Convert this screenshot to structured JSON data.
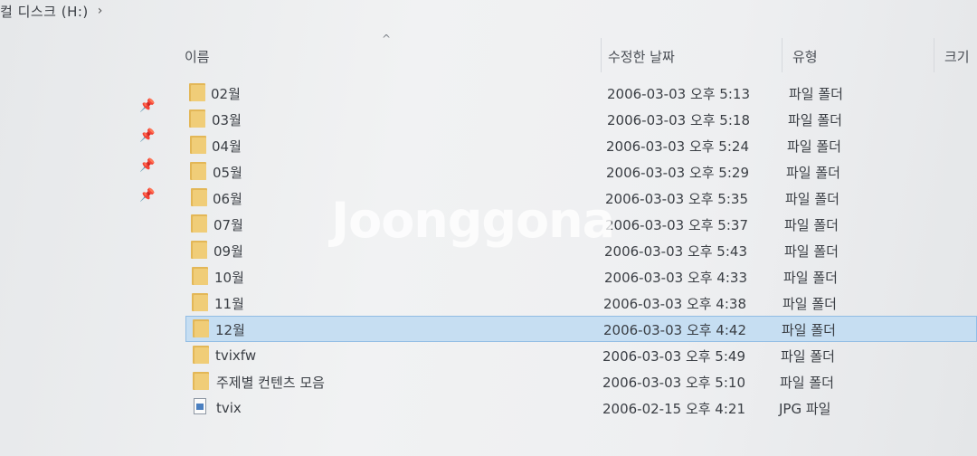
{
  "breadcrumb": {
    "text": "컬 디스크 (H:)",
    "chevron": "›"
  },
  "columns": {
    "name": "이름",
    "date": "수정한 날짜",
    "type": "유형",
    "size": "크기",
    "sort_indicator": "^"
  },
  "pins": [
    "pin-icon",
    "pin-icon",
    "pin-icon",
    "pin-icon"
  ],
  "files": [
    {
      "name": "02월",
      "date": "2006-03-03 오후 5:13",
      "type": "파일 폴더",
      "icon": "folder-icon"
    },
    {
      "name": "03월",
      "date": "2006-03-03 오후 5:18",
      "type": "파일 폴더",
      "icon": "folder-icon"
    },
    {
      "name": "04월",
      "date": "2006-03-03 오후 5:24",
      "type": "파일 폴더",
      "icon": "folder-icon"
    },
    {
      "name": "05월",
      "date": "2006-03-03 오후 5:29",
      "type": "파일 폴더",
      "icon": "folder-icon"
    },
    {
      "name": "06월",
      "date": "2006-03-03 오후 5:35",
      "type": "파일 폴더",
      "icon": "folder-icon"
    },
    {
      "name": "07월",
      "date": "2006-03-03 오후 5:37",
      "type": "파일 폴더",
      "icon": "folder-icon"
    },
    {
      "name": "09월",
      "date": "2006-03-03 오후 5:43",
      "type": "파일 폴더",
      "icon": "folder-icon"
    },
    {
      "name": "10월",
      "date": "2006-03-03 오후 4:33",
      "type": "파일 폴더",
      "icon": "folder-icon"
    },
    {
      "name": "11월",
      "date": "2006-03-03 오후 4:38",
      "type": "파일 폴더",
      "icon": "folder-icon"
    },
    {
      "name": "12월",
      "date": "2006-03-03 오후 4:42",
      "type": "파일 폴더",
      "icon": "folder-icon",
      "selected": true
    },
    {
      "name": "tvixfw",
      "date": "2006-03-03 오후 5:49",
      "type": "파일 폴더",
      "icon": "folder-icon"
    },
    {
      "name": "주제별 컨텐츠 모음",
      "date": "2006-03-03 오후 5:10",
      "type": "파일 폴더",
      "icon": "folder-icon"
    },
    {
      "name": "tvix",
      "date": "2006-02-15 오후 4:21",
      "type": "JPG 파일",
      "icon": "image-file-icon"
    }
  ],
  "watermark": "Joonggona",
  "colors": {
    "folder": "#f0cd78",
    "selection": "#c6def2",
    "selection_border": "#92bde4"
  }
}
